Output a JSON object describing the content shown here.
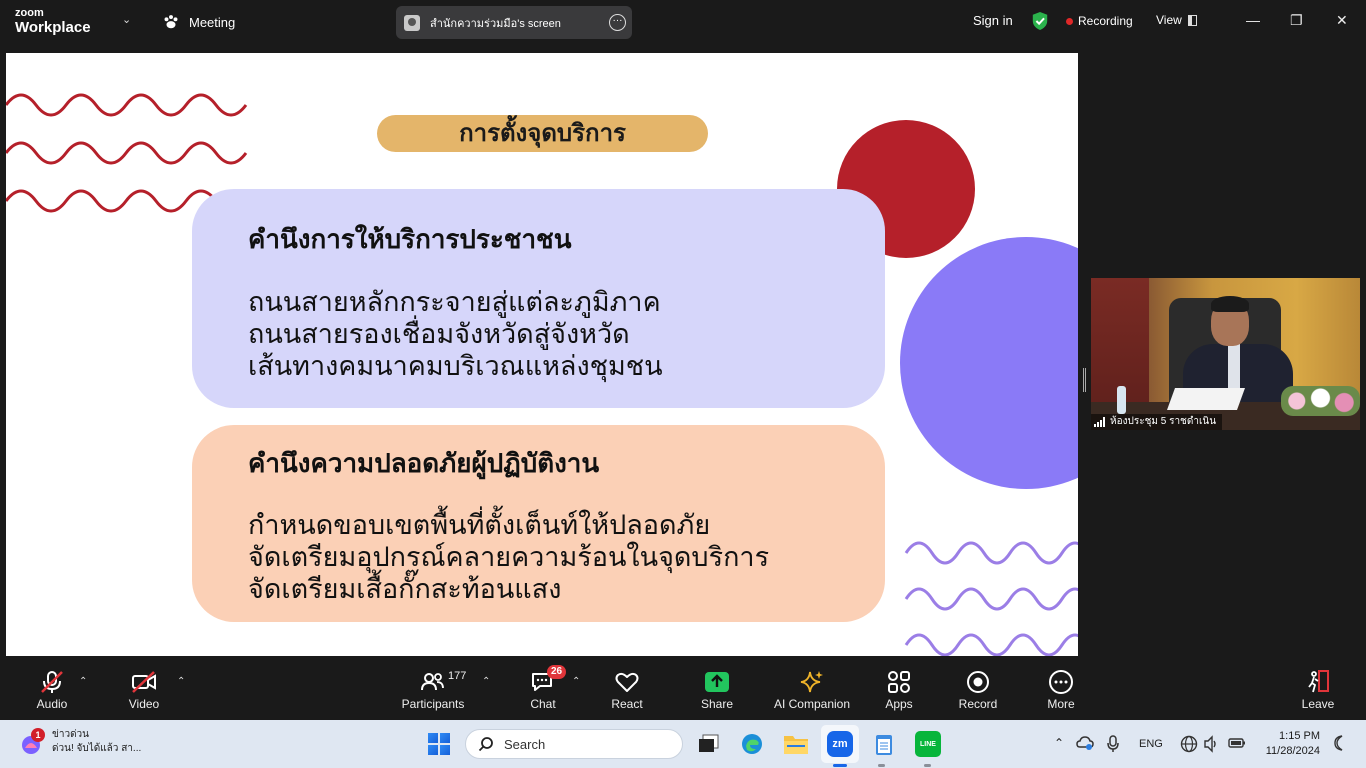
{
  "app": {
    "logo_line1": "zoom",
    "logo_line2": "Workplace",
    "meeting_label": "Meeting",
    "share_title": "สำนักความร่วมมือ's screen",
    "sign_in": "Sign in",
    "recording": "Recording",
    "view": "View",
    "colors": {
      "recording_dot": "#e02828",
      "shield": "#2bb24c",
      "share_green": "#22c55e"
    }
  },
  "slide": {
    "title": "การตั้งจุดบริการ",
    "card1": {
      "heading": "คำนึงการให้บริการประชาชน",
      "lines": [
        "ถนนสายหลักกระจายสู่แต่ละภูมิภาค",
        "ถนนสายรองเชื่อมจังหวัดสู่จังหวัด",
        "เส้นทางคมนาคมบริเวณแหล่งชุมชน"
      ]
    },
    "card2": {
      "heading": "คำนึงความปลอดภัยผู้ปฏิบัติงาน",
      "lines": [
        "กำหนดขอบเขตพื้นที่ตั้งเต็นท์ให้ปลอดภัย",
        "จัดเตรียมอุปกรณ์คลายความร้อนในจุดบริการ",
        "จัดเตรียมเสื้อกั๊กสะท้อนแสง"
      ]
    },
    "colors": {
      "title_bg": "#e4b56a",
      "card1_bg": "#d6d6fa",
      "card2_bg": "#fbd0b6",
      "red_circle": "#b5202a",
      "purple_circle": "#8a7af7",
      "wave_red": "#b5202a",
      "wave_purple": "#9b7ee6"
    }
  },
  "video": {
    "participant_name": "ห้องประชุม 5 ราชดำเนิน"
  },
  "toolbar": {
    "audio": "Audio",
    "video": "Video",
    "participants": "Participants",
    "participants_count": "177",
    "chat": "Chat",
    "chat_badge": "26",
    "react": "React",
    "share": "Share",
    "ai_companion": "AI Companion",
    "apps": "Apps",
    "record": "Record",
    "more": "More",
    "leave": "Leave"
  },
  "taskbar": {
    "news_badge": "1",
    "news_title": "ข่าวด่วน",
    "news_text": "ด่วน! จับได้แล้ว สา...",
    "search_placeholder": "Search",
    "zoom_app": "zm",
    "line_app": "LINE",
    "lang": "ENG",
    "time": "1:15 PM",
    "date": "11/28/2024"
  }
}
